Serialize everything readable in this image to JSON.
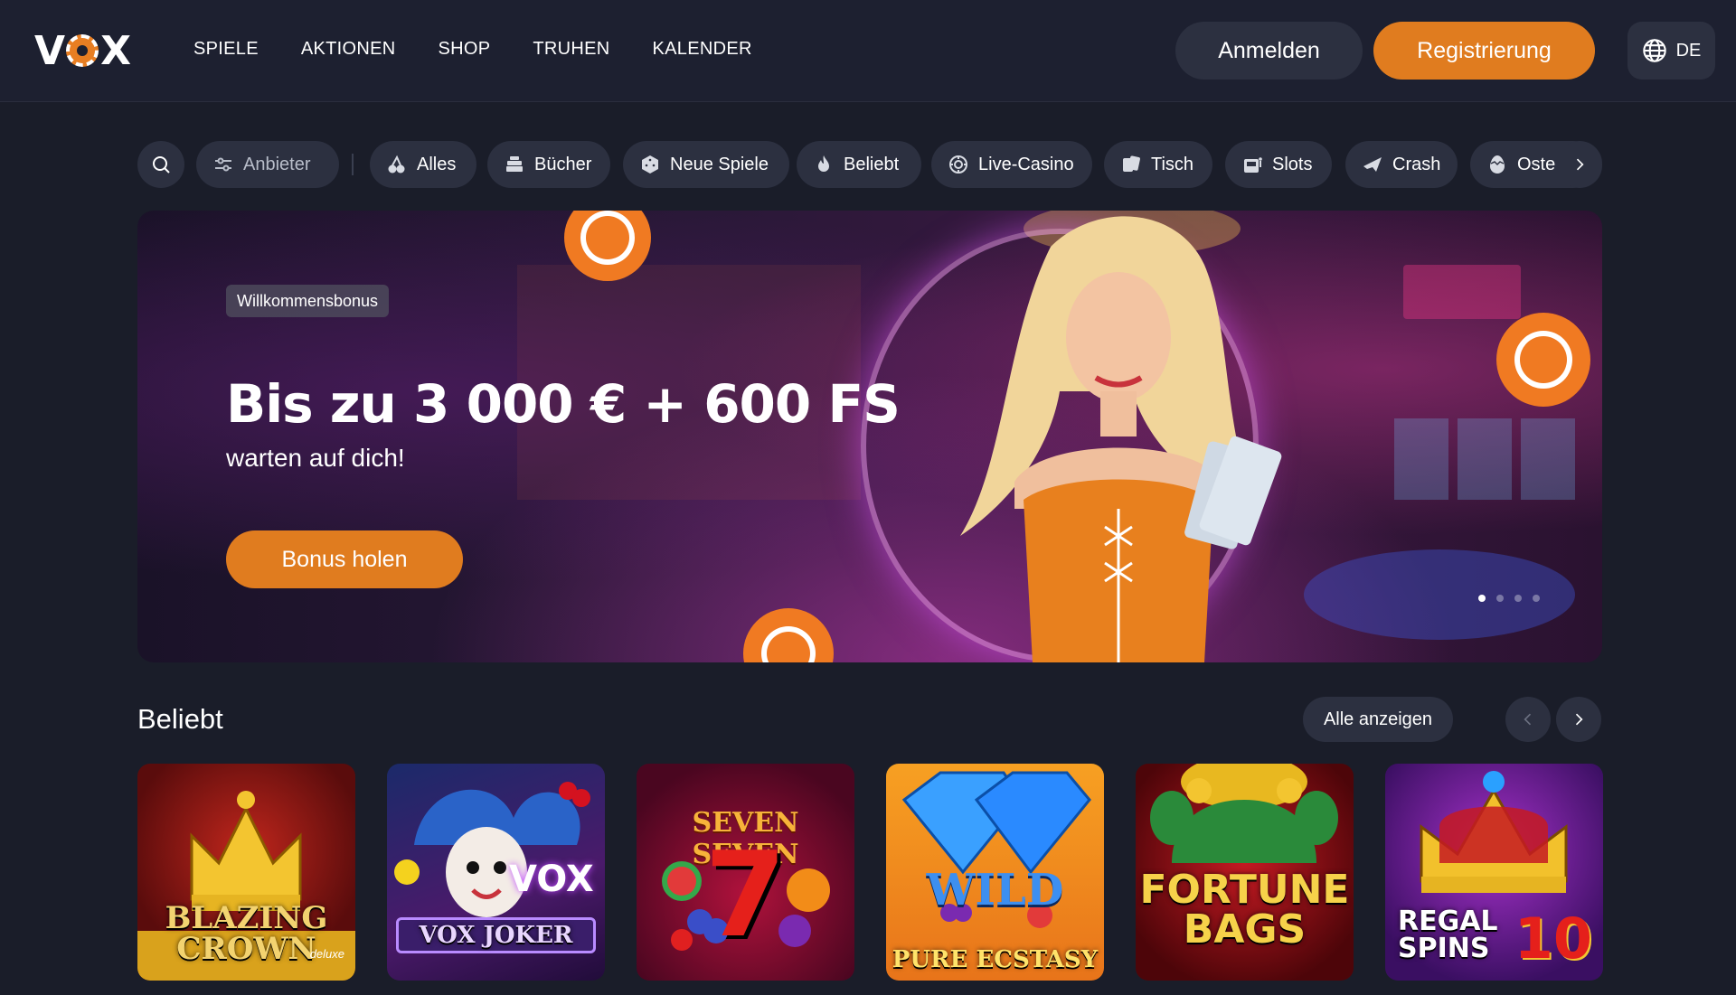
{
  "header": {
    "logo": "VOX",
    "nav": [
      "SPIELE",
      "AKTIONEN",
      "SHOP",
      "TRUHEN",
      "KALENDER"
    ],
    "login_label": "Anmelden",
    "register_label": "Registrierung",
    "lang_label": "DE"
  },
  "filters": {
    "provider_label": "Anbieter",
    "categories": [
      "Alles",
      "Bücher",
      "Neue Spiele",
      "Beliebt",
      "Live-Casino",
      "Tisch",
      "Slots",
      "Crash",
      "Oste"
    ]
  },
  "hero": {
    "badge": "Willkommensbonus",
    "title": "Bis zu 3 000 € + 600 FS",
    "subtitle": "warten auf dich!",
    "cta": "Bonus holen",
    "slide_count": 4,
    "active_slide": 1
  },
  "section": {
    "title": "Beliebt",
    "show_all": "Alle anzeigen"
  },
  "games": [
    {
      "name": "Blazing Crown",
      "title_line1": "BLAZING",
      "title_line2": "CROWN",
      "tag": "deluxe"
    },
    {
      "name": "Vox Joker",
      "title_line1": "VOX JOKER",
      "logo": "VOX"
    },
    {
      "name": "Seven Seven",
      "title_line1": "SEVEN SEVEN",
      "glyph": "7"
    },
    {
      "name": "Wild Pure Ecstasy",
      "title_line1": "WILD",
      "title_line2": "PURE ECSTASY"
    },
    {
      "name": "Fortune Bags",
      "title_line1": "FORTUNE",
      "title_line2": "BAGS"
    },
    {
      "name": "Regal Spins 10",
      "title_line1": "REGAL",
      "title_line2": "SPINS",
      "number": "10"
    }
  ],
  "colors": {
    "accent": "#e07c1f",
    "bg": "#1a1d29",
    "surface": "#2c3040"
  }
}
